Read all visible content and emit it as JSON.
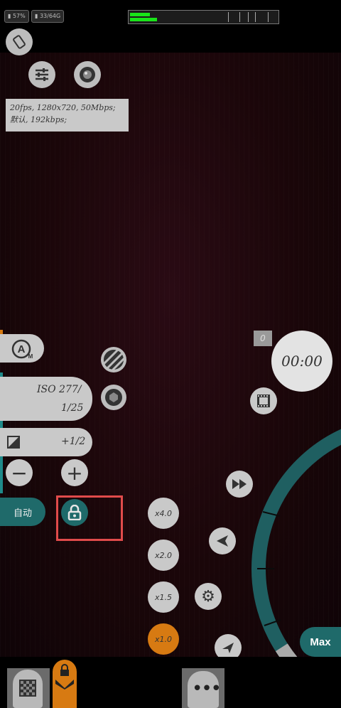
{
  "status": {
    "battery_text": "57%",
    "storage_text": "33/64G"
  },
  "info": {
    "line1": "20fps, 1280x720, 50Mbps;",
    "line2": "默认, 192kbps;"
  },
  "counter": "0",
  "timer": "00:00",
  "exposure": {
    "iso": "ISO 277/",
    "shutter": "1/25",
    "ev": "+1/2"
  },
  "auto_label": "自动",
  "zoom": [
    {
      "label": "x4.0"
    },
    {
      "label": "x2.0"
    },
    {
      "label": "x1.5"
    },
    {
      "label": "x1.0",
      "active": true
    }
  ],
  "max_label": "Max",
  "colors": {
    "accent": "#d77a12",
    "teal": "#1f6a6a",
    "highlight": "#e04b4b"
  }
}
